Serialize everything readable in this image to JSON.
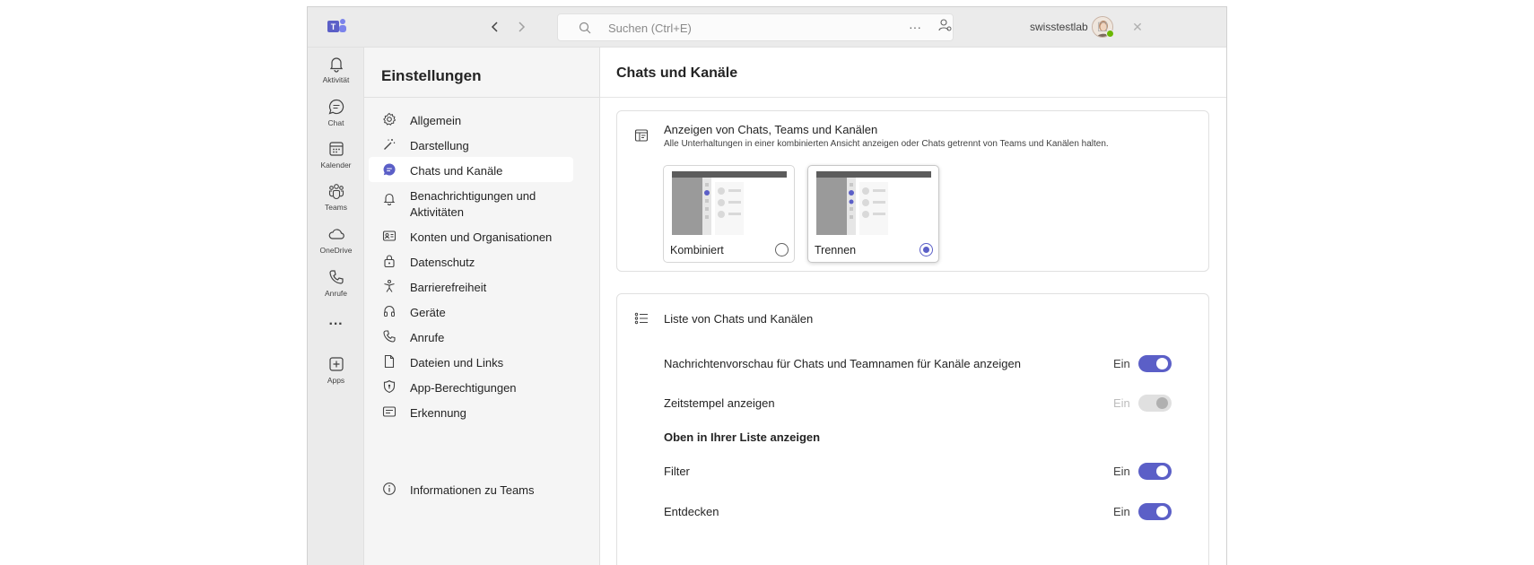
{
  "titlebar": {
    "search_placeholder": "Suchen (Ctrl+E)",
    "username": "swisstestlab",
    "more_label": "···"
  },
  "rail": {
    "items": [
      {
        "label": "Aktivität",
        "icon": "bell-icon"
      },
      {
        "label": "Chat",
        "icon": "chat-icon"
      },
      {
        "label": "Kalender",
        "icon": "calendar-icon"
      },
      {
        "label": "Teams",
        "icon": "teams-icon"
      },
      {
        "label": "OneDrive",
        "icon": "cloud-icon"
      },
      {
        "label": "Anrufe",
        "icon": "phone-icon"
      },
      {
        "label": "Apps",
        "icon": "add-apps-icon"
      }
    ],
    "more_label": "···"
  },
  "settings": {
    "title": "Einstellungen",
    "items": [
      {
        "label": "Allgemein",
        "icon": "gear-icon"
      },
      {
        "label": "Darstellung",
        "icon": "magic-wand-icon"
      },
      {
        "label": "Chats und Kanäle",
        "icon": "chat-bubble-icon",
        "active": true
      },
      {
        "label": "Benachrichtigungen und Aktivitäten",
        "icon": "bell-icon"
      },
      {
        "label": "Konten und Organisationen",
        "icon": "contact-card-icon"
      },
      {
        "label": "Datenschutz",
        "icon": "lock-icon"
      },
      {
        "label": "Barrierefreiheit",
        "icon": "accessibility-icon"
      },
      {
        "label": "Geräte",
        "icon": "headset-icon"
      },
      {
        "label": "Anrufe",
        "icon": "phone-icon"
      },
      {
        "label": "Dateien und Links",
        "icon": "document-icon"
      },
      {
        "label": "App-Berechtigungen",
        "icon": "shield-icon"
      },
      {
        "label": "Erkennung",
        "icon": "recognition-icon"
      }
    ],
    "about": {
      "label": "Informationen zu Teams",
      "icon": "info-icon"
    }
  },
  "main": {
    "title": "Chats und Kanäle",
    "view_card": {
      "heading": "Anzeigen von Chats, Teams und Kanälen",
      "subheading": "Alle Unterhaltungen in einer kombinierten Ansicht anzeigen oder Chats getrennt von Teams und Kanälen halten.",
      "options": [
        {
          "label": "Kombiniert",
          "selected": false
        },
        {
          "label": "Trennen",
          "selected": true
        }
      ]
    },
    "list_card": {
      "heading": "Liste von Chats und Kanälen",
      "settings": [
        {
          "label": "Nachrichtenvorschau für Chats und Teamnamen für Kanäle anzeigen",
          "value": "Ein",
          "enabled": true
        },
        {
          "label": "Zeitstempel anzeigen",
          "value": "Ein",
          "enabled": false
        }
      ],
      "section_title": "Oben in Ihrer Liste anzeigen",
      "top_settings": [
        {
          "label": "Filter",
          "value": "Ein",
          "enabled": true
        },
        {
          "label": "Entdecken",
          "value": "Ein",
          "enabled": true
        }
      ]
    }
  },
  "colors": {
    "accent": "#5b5fc7",
    "rail_bg": "#ebebeb",
    "status_available": "#6bb700"
  }
}
